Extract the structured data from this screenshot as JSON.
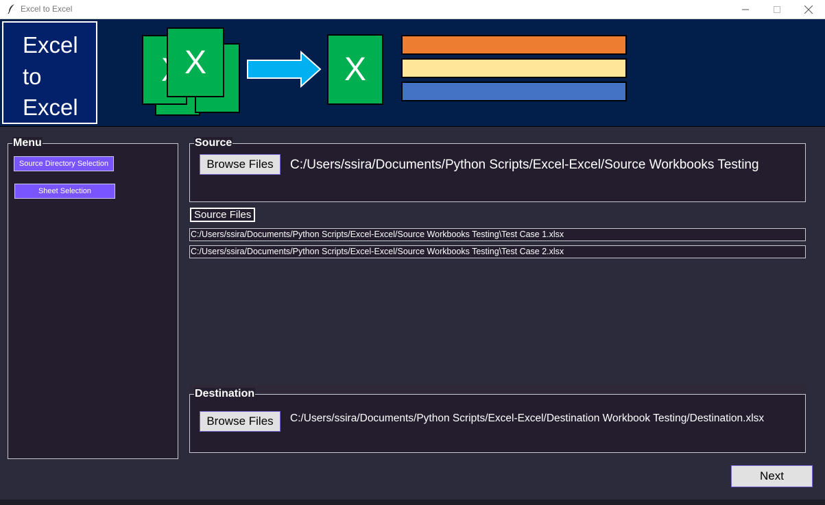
{
  "window": {
    "title": "Excel to Excel",
    "icon": "feather-icon"
  },
  "banner": {
    "logo_text": "Excel\nto\nExcel",
    "excel_letter": "X",
    "colors": {
      "background": "#021e4a",
      "excel_green": "#00b050",
      "arrow": "#00b0f0",
      "bar_orange": "#ed7d31",
      "bar_yellow": "#ffe699",
      "bar_blue": "#4472c4"
    }
  },
  "menu": {
    "title": "Menu",
    "items": [
      "Source Directory Selection",
      "Sheet Selection"
    ]
  },
  "source": {
    "title": "Source",
    "browse_label": "Browse Files",
    "path": "C:/Users/ssira/Documents/Python Scripts/Excel-Excel/Source Workbooks Testing"
  },
  "source_files": {
    "label": "Source Files",
    "files": [
      "C:/Users/ssira/Documents/Python Scripts/Excel-Excel/Source Workbooks Testing\\Test Case 1.xlsx",
      "C:/Users/ssira/Documents/Python Scripts/Excel-Excel/Source Workbooks Testing\\Test Case 2.xlsx"
    ]
  },
  "destination": {
    "title": "Destination",
    "browse_label": "Browse Files",
    "path": "C:/Users/ssira/Documents/Python Scripts/Excel-Excel/Destination Workbook Testing/Destination.xlsx"
  },
  "footer": {
    "next_label": "Next"
  },
  "theme": {
    "menu_button": "#7955ff",
    "panel_bg": "#231d2e",
    "window_bg": "#2b2b3b"
  }
}
